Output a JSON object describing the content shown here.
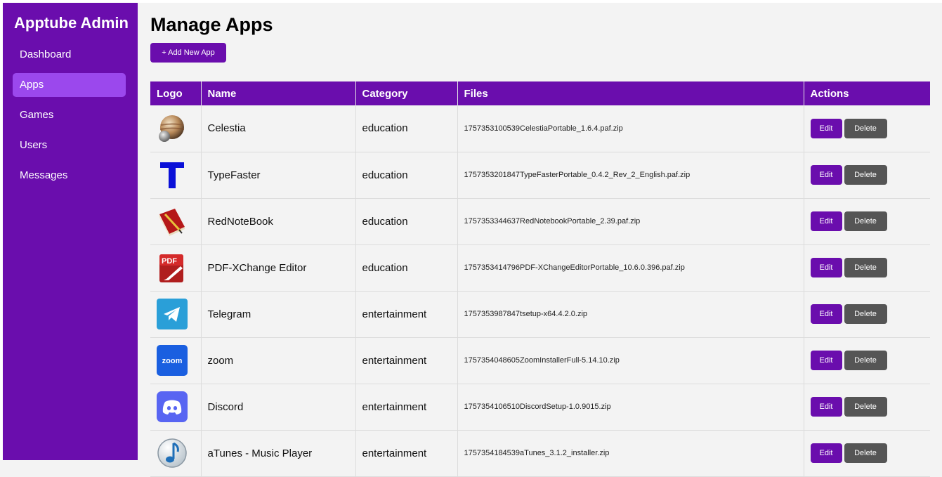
{
  "sidebar": {
    "brand": "Apptube Admin",
    "items": [
      {
        "label": "Dashboard",
        "active": false
      },
      {
        "label": "Apps",
        "active": true
      },
      {
        "label": "Games",
        "active": false
      },
      {
        "label": "Users",
        "active": false
      },
      {
        "label": "Messages",
        "active": false
      }
    ]
  },
  "main": {
    "title": "Manage Apps",
    "add_button": "+ Add New App"
  },
  "table": {
    "headers": [
      "Logo",
      "Name",
      "Category",
      "Files",
      "Actions"
    ],
    "edit_label": "Edit",
    "delete_label": "Delete",
    "rows": [
      {
        "logo_icon": "celestia-planet-icon",
        "name": "Celestia",
        "category": "education",
        "file": "1757353100539CelestiaPortable_1.6.4.paf.zip"
      },
      {
        "logo_icon": "typefaster-t-icon",
        "name": "TypeFaster",
        "category": "education",
        "file": "1757353201847TypeFasterPortable_0.4.2_Rev_2_English.paf.zip"
      },
      {
        "logo_icon": "rednotebook-book-icon",
        "name": "RedNoteBook",
        "category": "education",
        "file": "1757353344637RedNotebookPortable_2.39.paf.zip"
      },
      {
        "logo_icon": "pdf-xchange-icon",
        "name": "PDF-XChange Editor",
        "category": "education",
        "file": "1757353414796PDF-XChangeEditorPortable_10.6.0.396.paf.zip"
      },
      {
        "logo_icon": "telegram-icon",
        "name": "Telegram",
        "category": "entertainment",
        "file": "1757353987847tsetup-x64.4.2.0.zip"
      },
      {
        "logo_icon": "zoom-icon",
        "name": "zoom",
        "category": "entertainment",
        "file": "1757354048605ZoomInstallerFull-5.14.10.zip"
      },
      {
        "logo_icon": "discord-icon",
        "name": "Discord",
        "category": "entertainment",
        "file": "1757354106510DiscordSetup-1.0.9015.zip"
      },
      {
        "logo_icon": "atunes-music-note-icon",
        "name": "aTunes - Music Player",
        "category": "entertainment",
        "file": "1757354184539aTunes_3.1.2_installer.zip"
      }
    ]
  },
  "colors": {
    "accent": "#6a0dad",
    "sidebar_active": "#9b48ed",
    "delete": "#555555",
    "background": "#f3f3f3"
  },
  "logo_text": {
    "pdf": "PDF",
    "zoom": "zoom"
  }
}
